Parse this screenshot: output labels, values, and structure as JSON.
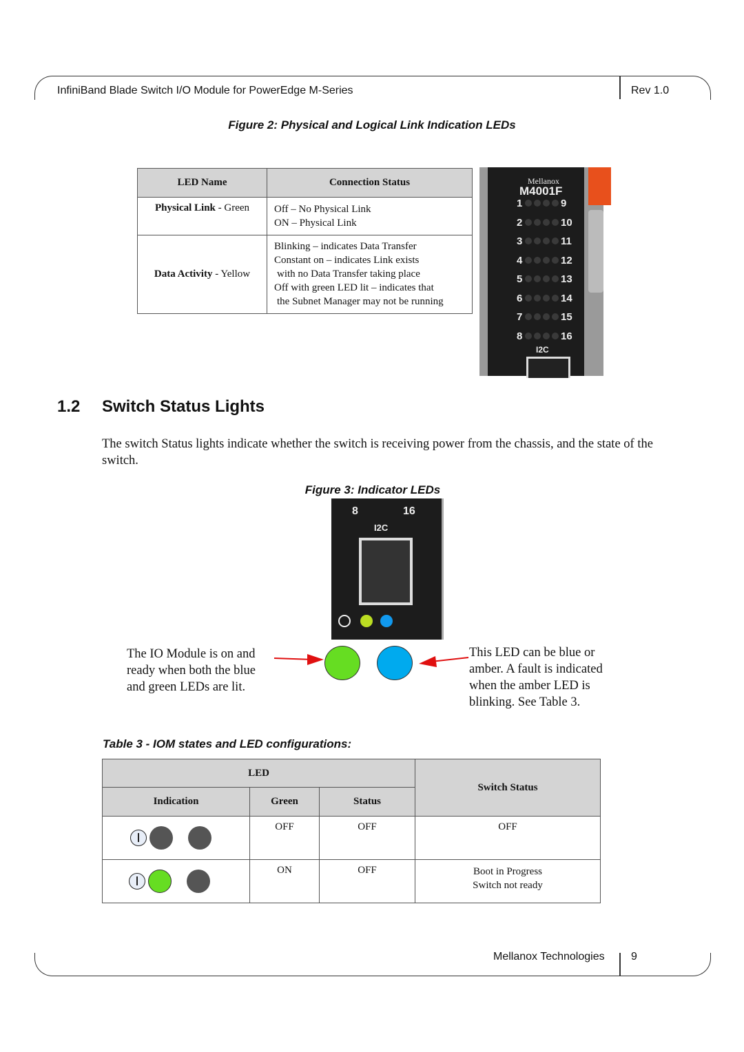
{
  "header": {
    "title": "InfiniBand Blade Switch I/O Module for PowerEdge M-Series",
    "rev": "Rev 1.0"
  },
  "figure2": {
    "caption": "Figure 2: Physical and Logical Link Indication LEDs",
    "table": {
      "headers": [
        "LED Name",
        "Connection Status"
      ],
      "rows": [
        {
          "name_bold": "Physical Link",
          "name_rest": " - Green",
          "status": [
            "Off – No Physical Link",
            "ON – Physical Link"
          ]
        },
        {
          "name_bold": "Data Activity",
          "name_rest": " - Yellow",
          "status": [
            "Blinking – indicates Data Transfer",
            "Constant on – indicates Link exists",
            "with no Data Transfer taking place",
            "Off with green LED lit – indicates that",
            "the Subnet Manager may not be running"
          ]
        }
      ]
    },
    "photo": {
      "brand": "Mellanox",
      "model": "M4001F",
      "ports_left": [
        "1",
        "2",
        "3",
        "4",
        "5",
        "6",
        "7",
        "8"
      ],
      "ports_right": [
        "9",
        "10",
        "11",
        "12",
        "13",
        "14",
        "15",
        "16"
      ],
      "i2c": "I2C"
    }
  },
  "section": {
    "number": "1.2",
    "title": "Switch Status Lights",
    "body": "The switch Status lights indicate whether the switch is receiving power from the chassis, and the state of the switch."
  },
  "figure3": {
    "caption": "Figure 3: Indicator LEDs",
    "photo": {
      "left": "8",
      "right": "16",
      "i2c": "I2C"
    },
    "left_note": "The IO Module is on and ready when both the blue and green LEDs are lit.",
    "right_note": "This LED can be blue or amber. A fault is indicated when the amber LED is blinking. See Table 3.",
    "colors": {
      "green": "#66dd22",
      "blue": "#00aaee",
      "arrow": "#e01010"
    }
  },
  "table3": {
    "caption": "Table 3 -  IOM states and LED configurations:",
    "headers": {
      "led": "LED",
      "indication": "Indication",
      "green": "Green",
      "status": "Status",
      "switch_status": "Switch Status"
    },
    "rows": [
      {
        "green_led": "off",
        "green": "OFF",
        "status": "OFF",
        "switch_status": [
          "OFF"
        ]
      },
      {
        "green_led": "on",
        "green": "ON",
        "status": "OFF",
        "switch_status": [
          "Boot in Progress",
          "Switch not ready"
        ]
      }
    ]
  },
  "footer": {
    "company": "Mellanox Technologies",
    "page": "9"
  }
}
